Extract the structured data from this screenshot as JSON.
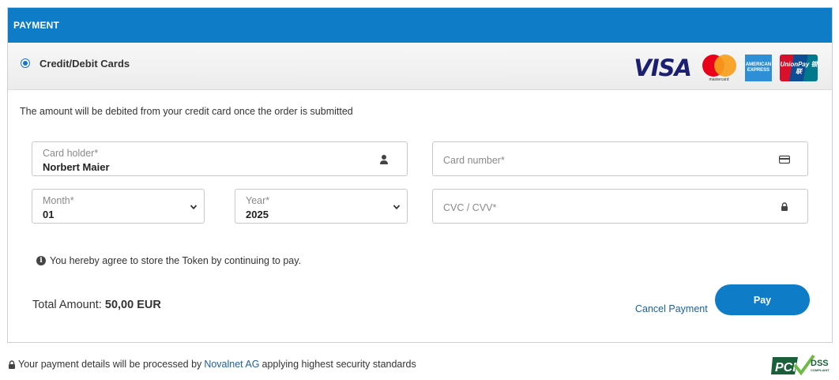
{
  "header": {
    "title": "PAYMENT"
  },
  "method": {
    "label": "Credit/Debit Cards",
    "selected": true,
    "logos": {
      "visa": "VISA",
      "mastercard": "mastercard",
      "amex": "AMERICAN EXPRESS",
      "unionpay": "UnionPay 银联"
    }
  },
  "notice": "The amount will be debited from your credit card once the order is submitted",
  "form": {
    "card_holder": {
      "label": "Card holder*",
      "value": "Norbert Maier"
    },
    "card_number": {
      "placeholder": "Card number*"
    },
    "month": {
      "label": "Month*",
      "value": "01"
    },
    "year": {
      "label": "Year*",
      "value": "2025"
    },
    "cvc": {
      "placeholder": "CVC / CVV*"
    }
  },
  "token_note": "You hereby agree to store the Token by continuing to pay.",
  "total": {
    "label": "Total Amount:",
    "value": "50,00 EUR"
  },
  "actions": {
    "cancel_label": "Cancel Payment",
    "pay_label": "Pay"
  },
  "footer": {
    "text_before": "Your payment details will be processed by",
    "link": "Novalnet AG",
    "text_after": "applying highest security standards",
    "pci_main": "PCI",
    "pci_dss": "DSS",
    "pci_compliant": "COMPLIANT"
  },
  "colors": {
    "brand": "#0e7cc6",
    "link": "#1d5f9c"
  },
  "icons": [
    "user-icon",
    "credit-card-icon",
    "lock-icon",
    "chevron-down-icon",
    "info-icon"
  ]
}
